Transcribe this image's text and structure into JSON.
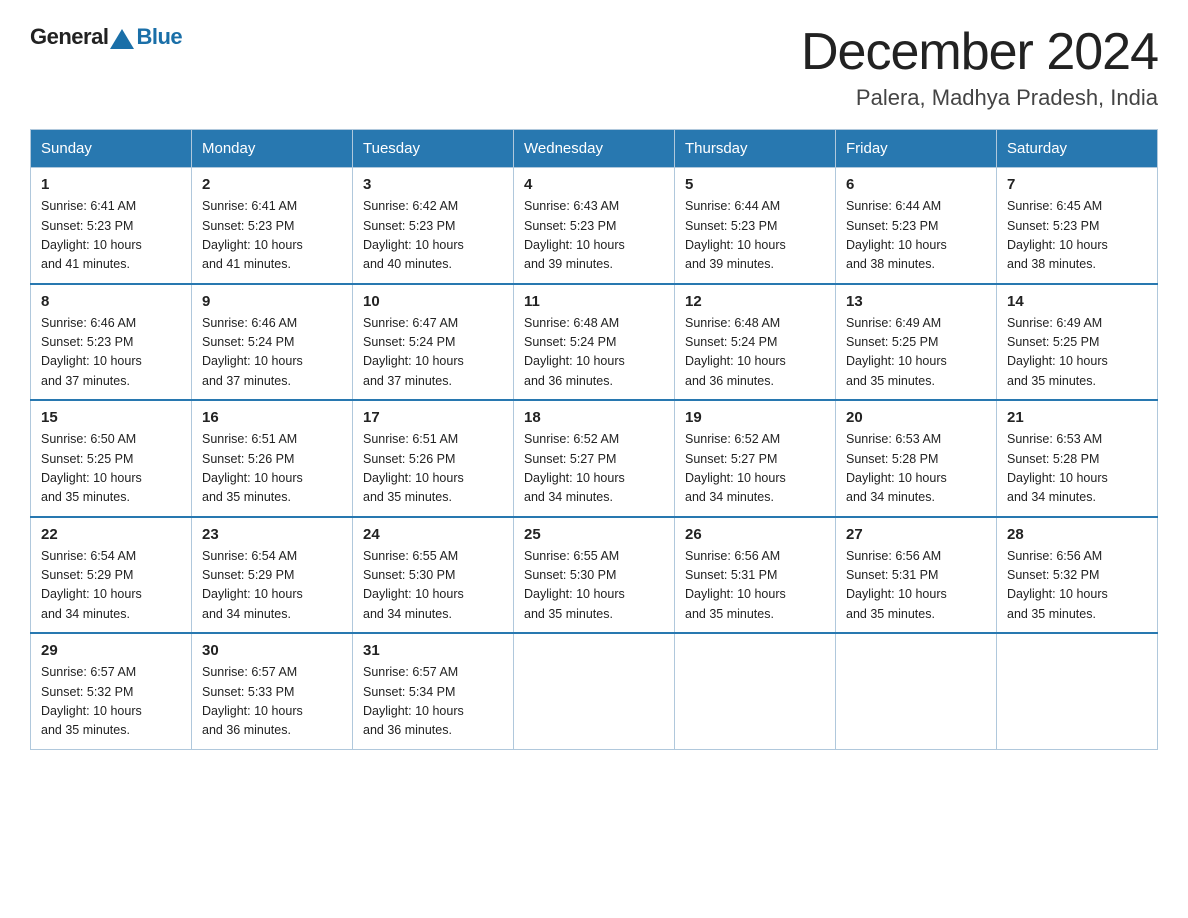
{
  "header": {
    "logo_general": "General",
    "logo_blue": "Blue",
    "month_title": "December 2024",
    "location": "Palera, Madhya Pradesh, India"
  },
  "days_of_week": [
    "Sunday",
    "Monday",
    "Tuesday",
    "Wednesday",
    "Thursday",
    "Friday",
    "Saturday"
  ],
  "weeks": [
    [
      {
        "day": "1",
        "sunrise": "6:41 AM",
        "sunset": "5:23 PM",
        "daylight": "10 hours and 41 minutes."
      },
      {
        "day": "2",
        "sunrise": "6:41 AM",
        "sunset": "5:23 PM",
        "daylight": "10 hours and 41 minutes."
      },
      {
        "day": "3",
        "sunrise": "6:42 AM",
        "sunset": "5:23 PM",
        "daylight": "10 hours and 40 minutes."
      },
      {
        "day": "4",
        "sunrise": "6:43 AM",
        "sunset": "5:23 PM",
        "daylight": "10 hours and 39 minutes."
      },
      {
        "day": "5",
        "sunrise": "6:44 AM",
        "sunset": "5:23 PM",
        "daylight": "10 hours and 39 minutes."
      },
      {
        "day": "6",
        "sunrise": "6:44 AM",
        "sunset": "5:23 PM",
        "daylight": "10 hours and 38 minutes."
      },
      {
        "day": "7",
        "sunrise": "6:45 AM",
        "sunset": "5:23 PM",
        "daylight": "10 hours and 38 minutes."
      }
    ],
    [
      {
        "day": "8",
        "sunrise": "6:46 AM",
        "sunset": "5:23 PM",
        "daylight": "10 hours and 37 minutes."
      },
      {
        "day": "9",
        "sunrise": "6:46 AM",
        "sunset": "5:24 PM",
        "daylight": "10 hours and 37 minutes."
      },
      {
        "day": "10",
        "sunrise": "6:47 AM",
        "sunset": "5:24 PM",
        "daylight": "10 hours and 37 minutes."
      },
      {
        "day": "11",
        "sunrise": "6:48 AM",
        "sunset": "5:24 PM",
        "daylight": "10 hours and 36 minutes."
      },
      {
        "day": "12",
        "sunrise": "6:48 AM",
        "sunset": "5:24 PM",
        "daylight": "10 hours and 36 minutes."
      },
      {
        "day": "13",
        "sunrise": "6:49 AM",
        "sunset": "5:25 PM",
        "daylight": "10 hours and 35 minutes."
      },
      {
        "day": "14",
        "sunrise": "6:49 AM",
        "sunset": "5:25 PM",
        "daylight": "10 hours and 35 minutes."
      }
    ],
    [
      {
        "day": "15",
        "sunrise": "6:50 AM",
        "sunset": "5:25 PM",
        "daylight": "10 hours and 35 minutes."
      },
      {
        "day": "16",
        "sunrise": "6:51 AM",
        "sunset": "5:26 PM",
        "daylight": "10 hours and 35 minutes."
      },
      {
        "day": "17",
        "sunrise": "6:51 AM",
        "sunset": "5:26 PM",
        "daylight": "10 hours and 35 minutes."
      },
      {
        "day": "18",
        "sunrise": "6:52 AM",
        "sunset": "5:27 PM",
        "daylight": "10 hours and 34 minutes."
      },
      {
        "day": "19",
        "sunrise": "6:52 AM",
        "sunset": "5:27 PM",
        "daylight": "10 hours and 34 minutes."
      },
      {
        "day": "20",
        "sunrise": "6:53 AM",
        "sunset": "5:28 PM",
        "daylight": "10 hours and 34 minutes."
      },
      {
        "day": "21",
        "sunrise": "6:53 AM",
        "sunset": "5:28 PM",
        "daylight": "10 hours and 34 minutes."
      }
    ],
    [
      {
        "day": "22",
        "sunrise": "6:54 AM",
        "sunset": "5:29 PM",
        "daylight": "10 hours and 34 minutes."
      },
      {
        "day": "23",
        "sunrise": "6:54 AM",
        "sunset": "5:29 PM",
        "daylight": "10 hours and 34 minutes."
      },
      {
        "day": "24",
        "sunrise": "6:55 AM",
        "sunset": "5:30 PM",
        "daylight": "10 hours and 34 minutes."
      },
      {
        "day": "25",
        "sunrise": "6:55 AM",
        "sunset": "5:30 PM",
        "daylight": "10 hours and 35 minutes."
      },
      {
        "day": "26",
        "sunrise": "6:56 AM",
        "sunset": "5:31 PM",
        "daylight": "10 hours and 35 minutes."
      },
      {
        "day": "27",
        "sunrise": "6:56 AM",
        "sunset": "5:31 PM",
        "daylight": "10 hours and 35 minutes."
      },
      {
        "day": "28",
        "sunrise": "6:56 AM",
        "sunset": "5:32 PM",
        "daylight": "10 hours and 35 minutes."
      }
    ],
    [
      {
        "day": "29",
        "sunrise": "6:57 AM",
        "sunset": "5:32 PM",
        "daylight": "10 hours and 35 minutes."
      },
      {
        "day": "30",
        "sunrise": "6:57 AM",
        "sunset": "5:33 PM",
        "daylight": "10 hours and 36 minutes."
      },
      {
        "day": "31",
        "sunrise": "6:57 AM",
        "sunset": "5:34 PM",
        "daylight": "10 hours and 36 minutes."
      },
      null,
      null,
      null,
      null
    ]
  ],
  "labels": {
    "sunrise": "Sunrise:",
    "sunset": "Sunset:",
    "daylight": "Daylight:"
  }
}
